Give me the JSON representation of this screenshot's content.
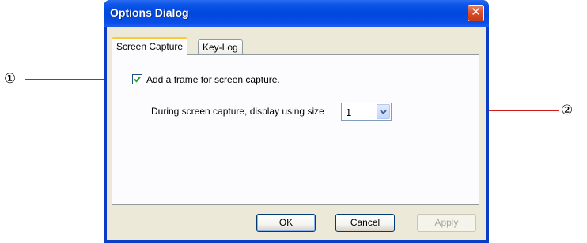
{
  "callouts": [
    {
      "label": "①"
    },
    {
      "label": "②"
    }
  ],
  "dialog": {
    "title": "Options Dialog",
    "close_symbol": "✕",
    "tabs": [
      {
        "label": "Screen Capture",
        "active": true
      },
      {
        "label": "Key-Log",
        "active": false
      }
    ],
    "frame_checkbox": {
      "label": "Add a frame for screen capture.",
      "checked": true
    },
    "size_label": "During screen capture, display using size",
    "size_select": {
      "value": "1"
    },
    "buttons": {
      "ok": "OK",
      "cancel": "Cancel",
      "apply": "Apply"
    }
  },
  "colors": {
    "titlebar": "#0047dd",
    "callout_line": "#d31a1a",
    "dialog_face": "#ece9d8"
  }
}
